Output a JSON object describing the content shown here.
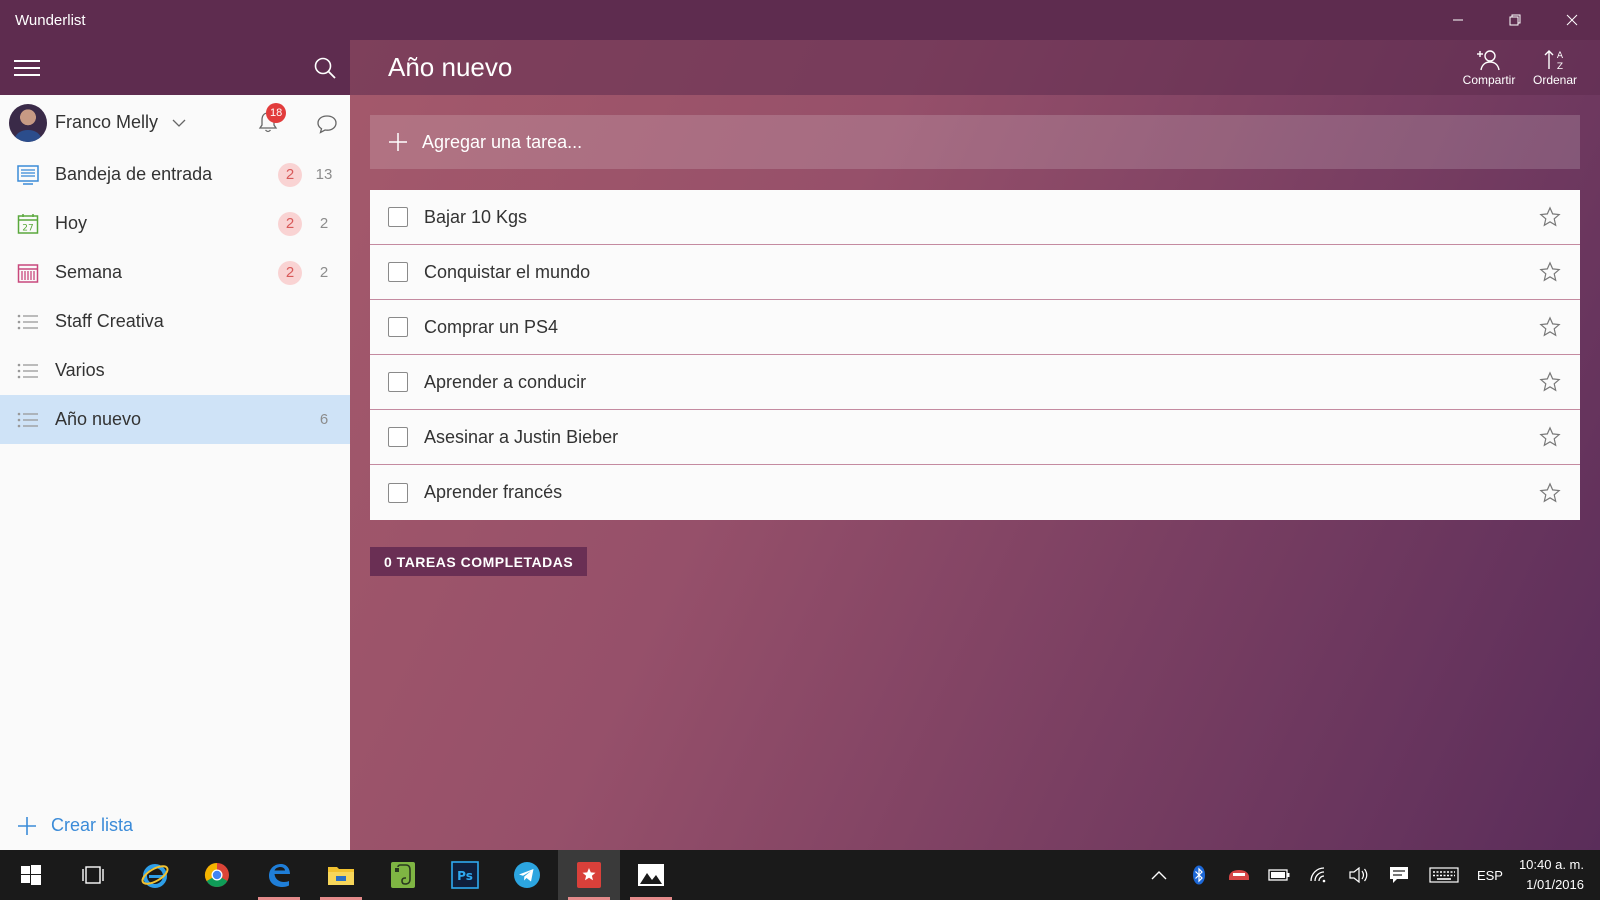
{
  "window": {
    "title": "Wunderlist"
  },
  "user": {
    "name": "Franco Melly",
    "notifications": "18"
  },
  "sidebar": {
    "items": [
      {
        "label": "Bandeja de entrada",
        "overdue": "2",
        "count": "13"
      },
      {
        "label": "Hoy",
        "overdue": "2",
        "count": "2",
        "date_icon_text": "27"
      },
      {
        "label": "Semana",
        "overdue": "2",
        "count": "2"
      },
      {
        "label": "Staff Creativa",
        "overdue": "",
        "count": ""
      },
      {
        "label": "Varios",
        "overdue": "",
        "count": ""
      },
      {
        "label": "Año nuevo",
        "overdue": "",
        "count": "6"
      }
    ],
    "create_list": "Crear lista"
  },
  "main": {
    "title": "Año nuevo",
    "share_label": "Compartir",
    "sort_label": "Ordenar",
    "add_task_placeholder": "Agregar una tarea...",
    "tasks": [
      {
        "label": "Bajar 10 Kgs"
      },
      {
        "label": "Conquistar el mundo"
      },
      {
        "label": "Comprar un PS4"
      },
      {
        "label": "Aprender a conducir"
      },
      {
        "label": "Asesinar a Justin Bieber"
      },
      {
        "label": "Aprender francés"
      }
    ],
    "completed_label": "0 TAREAS COMPLETADAS"
  },
  "taskbar": {
    "language": "ESP",
    "time": "10:40 a. m.",
    "date": "1/01/2016"
  },
  "colors": {
    "title_bar": "#5e2c4f",
    "accent_blue": "#3b8bd8",
    "overdue_badge": "#f9d3d3",
    "active_item": "#cfe3f7"
  }
}
